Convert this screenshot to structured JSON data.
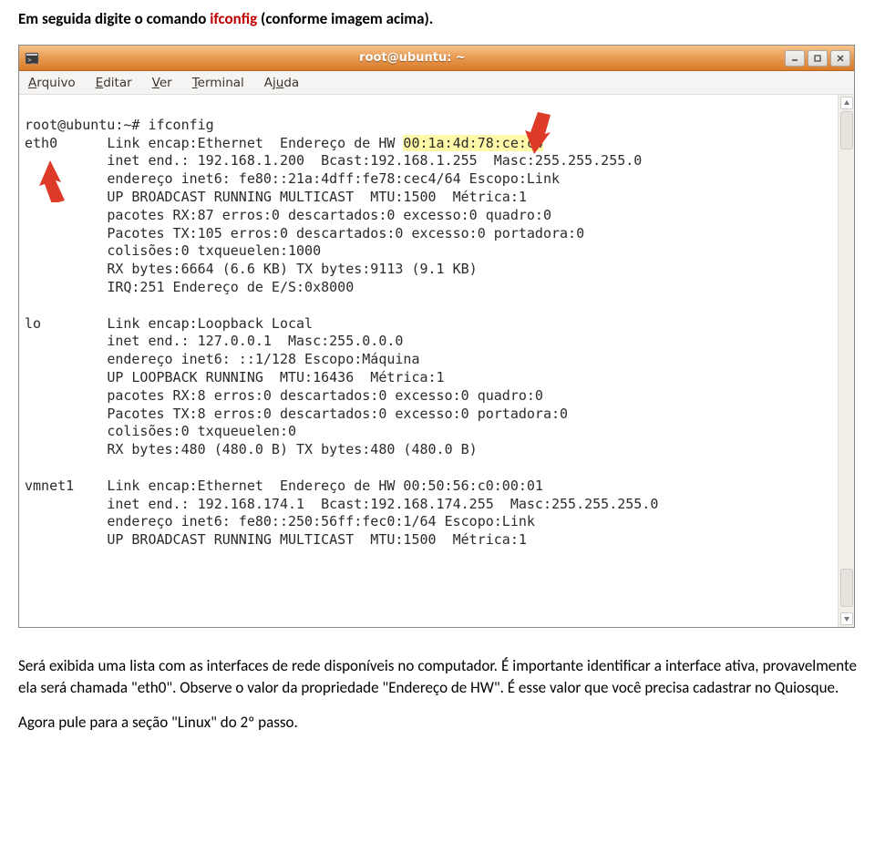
{
  "intro": {
    "prefix": "Em seguida digite o comando ",
    "cmd": "ifconfig",
    "suffix": " (conforme imagem acima)."
  },
  "window": {
    "title": "root@ubuntu: ~",
    "icons": {
      "app": "terminal-icon",
      "min": "_",
      "max": "□",
      "close": "×"
    }
  },
  "menu": {
    "items": [
      {
        "pre": "",
        "u": "A",
        "post": "rquivo"
      },
      {
        "pre": "",
        "u": "E",
        "post": "ditar"
      },
      {
        "pre": "",
        "u": "V",
        "post": "er"
      },
      {
        "pre": "",
        "u": "T",
        "post": "erminal"
      },
      {
        "pre": "Aj",
        "u": "u",
        "post": "da"
      }
    ]
  },
  "terminal": {
    "prompt": "root@ubuntu:~# ifconfig",
    "eth0_label": "eth0",
    "eth0": {
      "l1a": "Link encap:Ethernet  Endereço de HW ",
      "hw": "00:1a:4d:78:ce:c4",
      "l2": "inet end.: 192.168.1.200  Bcast:192.168.1.255  Masc:255.255.255.0",
      "l3": "endereço inet6: fe80::21a:4dff:fe78:cec4/64 Escopo:Link",
      "l4": "UP BROADCAST RUNNING MULTICAST  MTU:1500  Métrica:1",
      "l5": "pacotes RX:87 erros:0 descartados:0 excesso:0 quadro:0",
      "l6": "Pacotes TX:105 erros:0 descartados:0 excesso:0 portadora:0",
      "l7": "colisões:0 txqueuelen:1000",
      "l8": "RX bytes:6664 (6.6 KB) TX bytes:9113 (9.1 KB)",
      "l9": "IRQ:251 Endereço de E/S:0x8000"
    },
    "lo_label": "lo",
    "lo": {
      "l1": "Link encap:Loopback Local",
      "l2": "inet end.: 127.0.0.1  Masc:255.0.0.0",
      "l3": "endereço inet6: ::1/128 Escopo:Máquina",
      "l4": "UP LOOPBACK RUNNING  MTU:16436  Métrica:1",
      "l5": "pacotes RX:8 erros:0 descartados:0 excesso:0 quadro:0",
      "l6": "Pacotes TX:8 erros:0 descartados:0 excesso:0 portadora:0",
      "l7": "colisões:0 txqueuelen:0",
      "l8": "RX bytes:480 (480.0 B) TX bytes:480 (480.0 B)"
    },
    "vmnet1_label": "vmnet1",
    "vmnet1": {
      "l1": "Link encap:Ethernet  Endereço de HW 00:50:56:c0:00:01",
      "l2": "inet end.: 192.168.174.1  Bcast:192.168.174.255  Masc:255.255.255.0",
      "l3": "endereço inet6: fe80::250:56ff:fec0:1/64 Escopo:Link",
      "l4": "UP BROADCAST RUNNING MULTICAST  MTU:1500  Métrica:1"
    }
  },
  "outro": {
    "p1": "Será exibida uma lista com as interfaces de rede disponíveis no computador. É importante identificar a interface ativa, provavelmente ela será chamada \"eth0\". Observe o valor da propriedade \"Endereço de HW\". É esse valor que você precisa cadastrar no Quiosque.",
    "p2": "Agora pule para a seção \"Linux\" do 2º passo."
  }
}
